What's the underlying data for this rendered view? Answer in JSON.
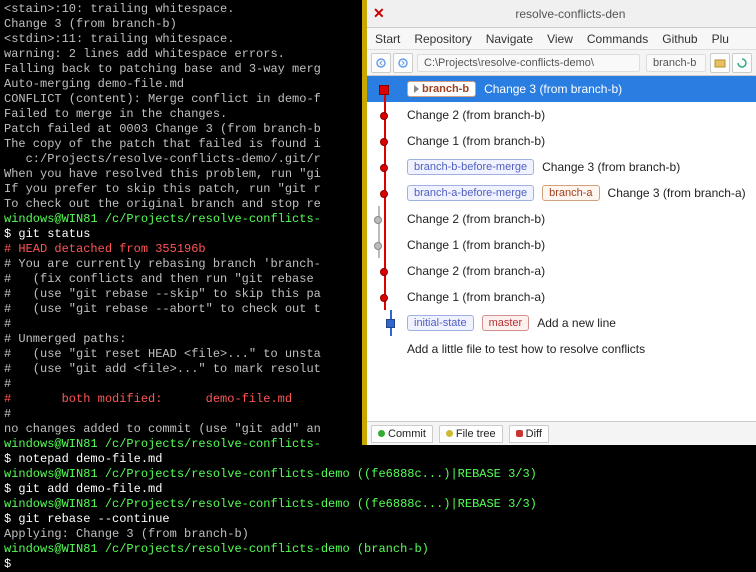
{
  "terminal": {
    "lines": [
      {
        "cls": "",
        "txt": "<stain>:10: trailing whitespace."
      },
      {
        "cls": "",
        "txt": "Change 3 (from branch-b)"
      },
      {
        "cls": "",
        "txt": "<stdin>:11: trailing whitespace."
      },
      {
        "cls": "",
        "txt": ""
      },
      {
        "cls": "",
        "txt": "warning: 2 lines add whitespace errors."
      },
      {
        "cls": "",
        "txt": "Falling back to patching base and 3-way merg"
      },
      {
        "cls": "",
        "txt": "Auto-merging demo-file.md"
      },
      {
        "cls": "",
        "txt": "CONFLICT (content): Merge conflict in demo-f"
      },
      {
        "cls": "",
        "txt": "Failed to merge in the changes."
      },
      {
        "cls": "",
        "txt": "Patch failed at 0003 Change 3 (from branch-b"
      },
      {
        "cls": "",
        "txt": "The copy of the patch that failed is found i"
      },
      {
        "cls": "",
        "txt": "   c:/Projects/resolve-conflicts-demo/.git/r"
      },
      {
        "cls": "",
        "txt": ""
      },
      {
        "cls": "",
        "txt": "When you have resolved this problem, run \"gi"
      },
      {
        "cls": "",
        "txt": "If you prefer to skip this patch, run \"git r"
      },
      {
        "cls": "",
        "txt": "To check out the original branch and stop re"
      },
      {
        "cls": "",
        "txt": ""
      },
      {
        "cls": "",
        "txt": ""
      },
      {
        "cls": "t-green",
        "txt": "windows@WIN81 /c/Projects/resolve-conflicts-"
      },
      {
        "cls": "t-white",
        "txt": "$ git status"
      },
      {
        "cls": "t-red",
        "txt": "# HEAD detached from 355196b"
      },
      {
        "cls": "",
        "txt": "# You are currently rebasing branch 'branch-"
      },
      {
        "cls": "",
        "txt": "#   (fix conflicts and then run \"git rebase "
      },
      {
        "cls": "",
        "txt": "#   (use \"git rebase --skip\" to skip this pa"
      },
      {
        "cls": "",
        "txt": "#   (use \"git rebase --abort\" to check out t"
      },
      {
        "cls": "",
        "txt": "#"
      },
      {
        "cls": "",
        "txt": "# Unmerged paths:"
      },
      {
        "cls": "",
        "txt": "#   (use \"git reset HEAD <file>...\" to unsta"
      },
      {
        "cls": "",
        "txt": "#   (use \"git add <file>...\" to mark resolut"
      },
      {
        "cls": "",
        "txt": "#"
      },
      {
        "cls": "t-red",
        "txt": "#       both modified:      demo-file.md"
      },
      {
        "cls": "",
        "txt": "#"
      },
      {
        "cls": "",
        "txt": "no changes added to commit (use \"git add\" an"
      },
      {
        "cls": "",
        "txt": ""
      },
      {
        "cls": "t-green",
        "txt": "windows@WIN81 /c/Projects/resolve-conflicts-"
      },
      {
        "cls": "t-white",
        "txt": "$ notepad demo-file.md"
      },
      {
        "cls": "",
        "txt": ""
      },
      {
        "cls": "t-green",
        "txt": "windows@WIN81 /c/Projects/resolve-conflicts-demo ((fe6888c...)|REBASE 3/3)"
      },
      {
        "cls": "t-white",
        "txt": "$ git add demo-file.md"
      },
      {
        "cls": "",
        "txt": ""
      },
      {
        "cls": "t-green",
        "txt": "windows@WIN81 /c/Projects/resolve-conflicts-demo ((fe6888c...)|REBASE 3/3)"
      },
      {
        "cls": "t-white",
        "txt": "$ git rebase --continue"
      },
      {
        "cls": "",
        "txt": "Applying: Change 3 (from branch-b)"
      },
      {
        "cls": "",
        "txt": ""
      },
      {
        "cls": "t-green",
        "txt": "windows@WIN81 /c/Projects/resolve-conflicts-demo (branch-b)"
      },
      {
        "cls": "t-white",
        "txt": "$"
      }
    ]
  },
  "gitwin": {
    "title": "resolve-conflicts-den",
    "menus": [
      "Start",
      "Repository",
      "Navigate",
      "View",
      "Commands",
      "Github",
      "Plu"
    ],
    "path": "C:\\Projects\\resolve-conflicts-demo\\",
    "branch": "branch-b",
    "log": [
      {
        "sel": true,
        "node": "sq",
        "refs": [
          {
            "t": "branch",
            "v": "branch-b",
            "arrow": true
          }
        ],
        "msg": "Change 3 (from branch-b)"
      },
      {
        "node": "ci",
        "msg": "Change 2 (from branch-b)"
      },
      {
        "node": "ci",
        "msg": "Change 1 (from branch-b)"
      },
      {
        "node": "ci",
        "refs": [
          {
            "t": "initial",
            "v": "branch-b-before-merge"
          }
        ],
        "msg": "Change 3 (from branch-b)"
      },
      {
        "node": "ci",
        "refs": [
          {
            "t": "initial",
            "v": "branch-a-before-merge"
          },
          {
            "t": "branch",
            "v": "branch-a"
          }
        ],
        "msg": "Change 3 (from branch-a)"
      },
      {
        "node": "cig",
        "msg": "Change 2 (from branch-b)"
      },
      {
        "node": "cig",
        "msg": "Change 1 (from branch-b)"
      },
      {
        "node": "ci",
        "msg": "Change 2 (from branch-a)"
      },
      {
        "node": "ci",
        "msg": "Change 1 (from branch-a)"
      },
      {
        "node": "blue",
        "refs": [
          {
            "t": "initial",
            "v": "initial-state"
          },
          {
            "t": "master",
            "v": "master"
          }
        ],
        "msg": "Add a new line"
      },
      {
        "msg": "Add a little file to test how to resolve conflicts"
      }
    ],
    "bottom": {
      "commit": "Commit",
      "filetree": "File tree",
      "diff": "Diff"
    }
  }
}
